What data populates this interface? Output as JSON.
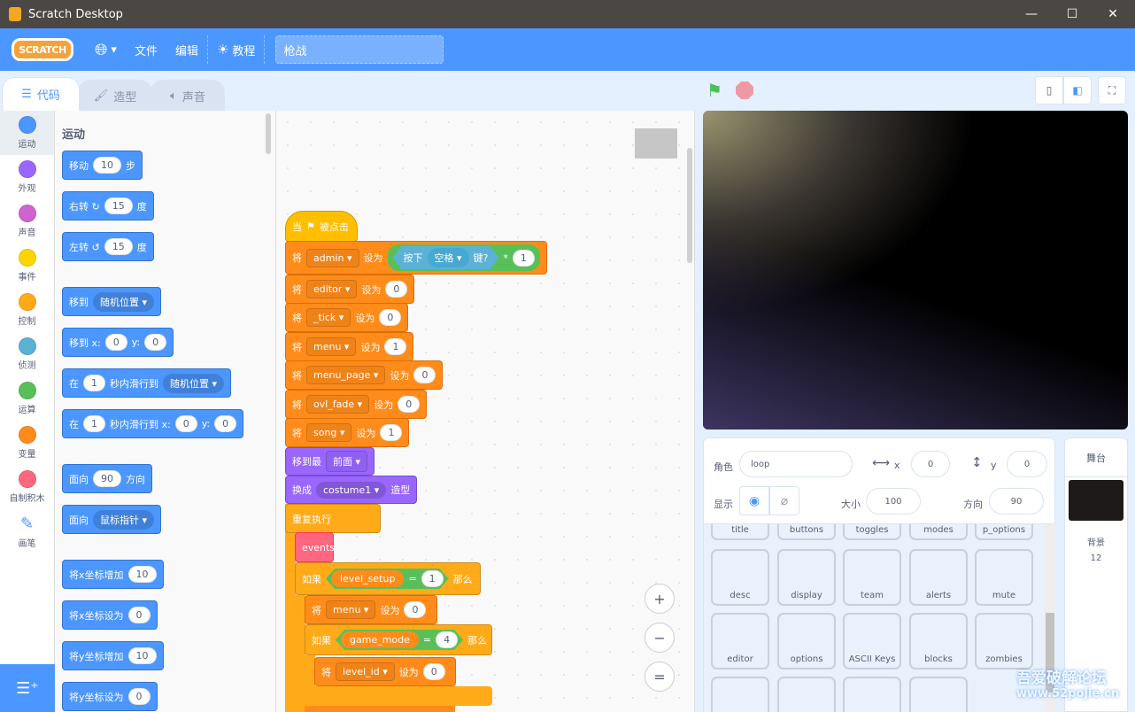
{
  "window": {
    "title": "Scratch Desktop",
    "minimize": "—",
    "maximize": "☐",
    "close": "✕"
  },
  "menu": {
    "logo": "SCRATCH",
    "language_icon": "globe-icon",
    "file": "文件",
    "edit": "编辑",
    "tutorials": "教程",
    "project_title": "枪战"
  },
  "tabs": [
    {
      "label": "代码",
      "icon": "code-icon"
    },
    {
      "label": "造型",
      "icon": "brush-icon"
    },
    {
      "label": "声音",
      "icon": "speaker-icon"
    }
  ],
  "categories": [
    {
      "label": "运动",
      "color": "#4c97ff"
    },
    {
      "label": "外观",
      "color": "#9966ff"
    },
    {
      "label": "声音",
      "color": "#cf63cf"
    },
    {
      "label": "事件",
      "color": "#ffd500"
    },
    {
      "label": "控制",
      "color": "#ffab19"
    },
    {
      "label": "侦测",
      "color": "#5cb1d6"
    },
    {
      "label": "运算",
      "color": "#59c059"
    },
    {
      "label": "变量",
      "color": "#ff8c1a"
    },
    {
      "label": "自制积木",
      "color": "#ff6680"
    },
    {
      "label": "画笔",
      "color": "pen-icon"
    }
  ],
  "palette": {
    "title": "运动",
    "blocks": [
      [
        {
          "t": "移动"
        },
        {
          "v": "10"
        },
        {
          "t": "步"
        }
      ],
      [
        {
          "t": "右转 ↻"
        },
        {
          "v": "15"
        },
        {
          "t": "度"
        }
      ],
      [
        {
          "t": "左转 ↺"
        },
        {
          "v": "15"
        },
        {
          "t": "度"
        }
      ],
      [
        {
          "t": "移到"
        },
        {
          "r": "随机位置"
        }
      ],
      [
        {
          "t": "移到 x:"
        },
        {
          "v": "0"
        },
        {
          "t": "y:"
        },
        {
          "v": "0"
        }
      ],
      [
        {
          "t": "在"
        },
        {
          "v": "1"
        },
        {
          "t": "秒内滑行到"
        },
        {
          "r": "随机位置"
        }
      ],
      [
        {
          "t": "在"
        },
        {
          "v": "1"
        },
        {
          "t": "秒内滑行到 x:"
        },
        {
          "v": "0"
        },
        {
          "t": "y:"
        },
        {
          "v": "0"
        }
      ],
      [
        {
          "t": "面向"
        },
        {
          "v": "90"
        },
        {
          "t": "方向"
        }
      ],
      [
        {
          "t": "面向"
        },
        {
          "r": "鼠标指针"
        }
      ],
      [
        {
          "t": "将x坐标增加"
        },
        {
          "v": "10"
        }
      ],
      [
        {
          "t": "将x坐标设为"
        },
        {
          "v": "0"
        }
      ],
      [
        {
          "t": "将y坐标增加"
        },
        {
          "v": "10"
        }
      ],
      [
        {
          "t": "将y坐标设为"
        },
        {
          "v": "0"
        }
      ]
    ]
  },
  "script": [
    {
      "cls": "event",
      "parts": [
        {
          "t": "当"
        },
        {
          "t": "⚑"
        },
        {
          "t": "被点击"
        }
      ]
    },
    {
      "cls": "var",
      "parts": [
        {
          "t": "将"
        },
        {
          "d": "admin"
        },
        {
          "t": "设为"
        },
        {
          "op": [
            {
              "sense": [
                {
                  "t": "按下"
                },
                {
                  "r": "空格"
                },
                {
                  "t": "键?"
                }
              ]
            },
            {
              "t": "*"
            },
            {
              "v": "1"
            }
          ]
        }
      ]
    },
    {
      "cls": "var",
      "parts": [
        {
          "t": "将"
        },
        {
          "d": "editor"
        },
        {
          "t": "设为"
        },
        {
          "v": "0"
        }
      ]
    },
    {
      "cls": "var",
      "parts": [
        {
          "t": "将"
        },
        {
          "d": "_tick"
        },
        {
          "t": "设为"
        },
        {
          "v": "0"
        }
      ]
    },
    {
      "cls": "var",
      "parts": [
        {
          "t": "将"
        },
        {
          "d": "menu"
        },
        {
          "t": "设为"
        },
        {
          "v": "1"
        }
      ]
    },
    {
      "cls": "var",
      "parts": [
        {
          "t": "将"
        },
        {
          "d": "menu_page"
        },
        {
          "t": "设为"
        },
        {
          "v": "0"
        }
      ]
    },
    {
      "cls": "var",
      "parts": [
        {
          "t": "将"
        },
        {
          "d": "ovl_fade"
        },
        {
          "t": "设为"
        },
        {
          "v": "0"
        }
      ]
    },
    {
      "cls": "var",
      "parts": [
        {
          "t": "将"
        },
        {
          "d": "song"
        },
        {
          "t": "设为"
        },
        {
          "v": "1"
        }
      ]
    },
    {
      "cls": "looks",
      "parts": [
        {
          "t": "移到最"
        },
        {
          "d": "前面"
        }
      ]
    },
    {
      "cls": "looks",
      "parts": [
        {
          "t": "换成"
        },
        {
          "r": "costume1"
        },
        {
          "t": "造型"
        }
      ]
    },
    {
      "cls": "ctrl",
      "parts": [
        {
          "t": "重复执行"
        }
      ]
    },
    {
      "cls": "myb",
      "parts": [
        {
          "t": "events"
        }
      ]
    },
    {
      "cls": "ctrl",
      "parts": [
        {
          "t": "如果"
        },
        {
          "eq": [
            {
              "rep": "level_setup"
            },
            {
              "t": "="
            },
            {
              "v": "1"
            }
          ]
        },
        {
          "t": "那么"
        }
      ]
    },
    {
      "cls": "var",
      "parts": [
        {
          "t": "将"
        },
        {
          "d": "menu"
        },
        {
          "t": "设为"
        },
        {
          "v": "0"
        }
      ]
    },
    {
      "cls": "ctrl",
      "parts": [
        {
          "t": "如果"
        },
        {
          "eq": [
            {
              "rep": "game_mode"
            },
            {
              "t": "="
            },
            {
              "v": "4"
            }
          ]
        },
        {
          "t": "那么"
        }
      ]
    },
    {
      "cls": "var",
      "parts": [
        {
          "t": "将"
        },
        {
          "d": "level_id"
        },
        {
          "t": "设为"
        },
        {
          "v": "0"
        }
      ]
    }
  ],
  "zoom": {
    "in": "+",
    "out": "−",
    "reset": "="
  },
  "stage_controls": {
    "green_flag": "green-flag-icon",
    "stop": "stop-icon",
    "small_stage": "small-stage-icon",
    "large_stage": "large-stage-icon",
    "fullscreen": "fullscreen-icon"
  },
  "sprite_info": {
    "sprite_label": "角色",
    "sprite_name": "loop",
    "x_label": "x",
    "x": "0",
    "y_label": "y",
    "y": "0",
    "show_label": "显示",
    "size_label": "大小",
    "size": "100",
    "direction_label": "方向",
    "direction": "90"
  },
  "sprites": [
    "title",
    "buttons",
    "toggles",
    "modes",
    "p_options",
    "desc",
    "display",
    "team",
    "alerts",
    "mute",
    "editor",
    "options",
    "ASCII Keys",
    "blocks",
    "zombies",
    "",
    "",
    "",
    ""
  ],
  "stage_panel": {
    "title": "舞台",
    "backdrop_label": "背景",
    "backdrop_count": "12"
  },
  "watermark": {
    "line1": "吾爱破解论坛",
    "line2": "www.52pojie.cn"
  },
  "colors": {
    "menu": "#4c97ff",
    "motion": "#4c97ff",
    "variables": "#ff8c1a",
    "looks": "#9966ff",
    "events": "#ffbf00",
    "control": "#ffab19",
    "my_blocks": "#ff6680",
    "operators": "#59c059",
    "sensing": "#5cb1d6"
  }
}
